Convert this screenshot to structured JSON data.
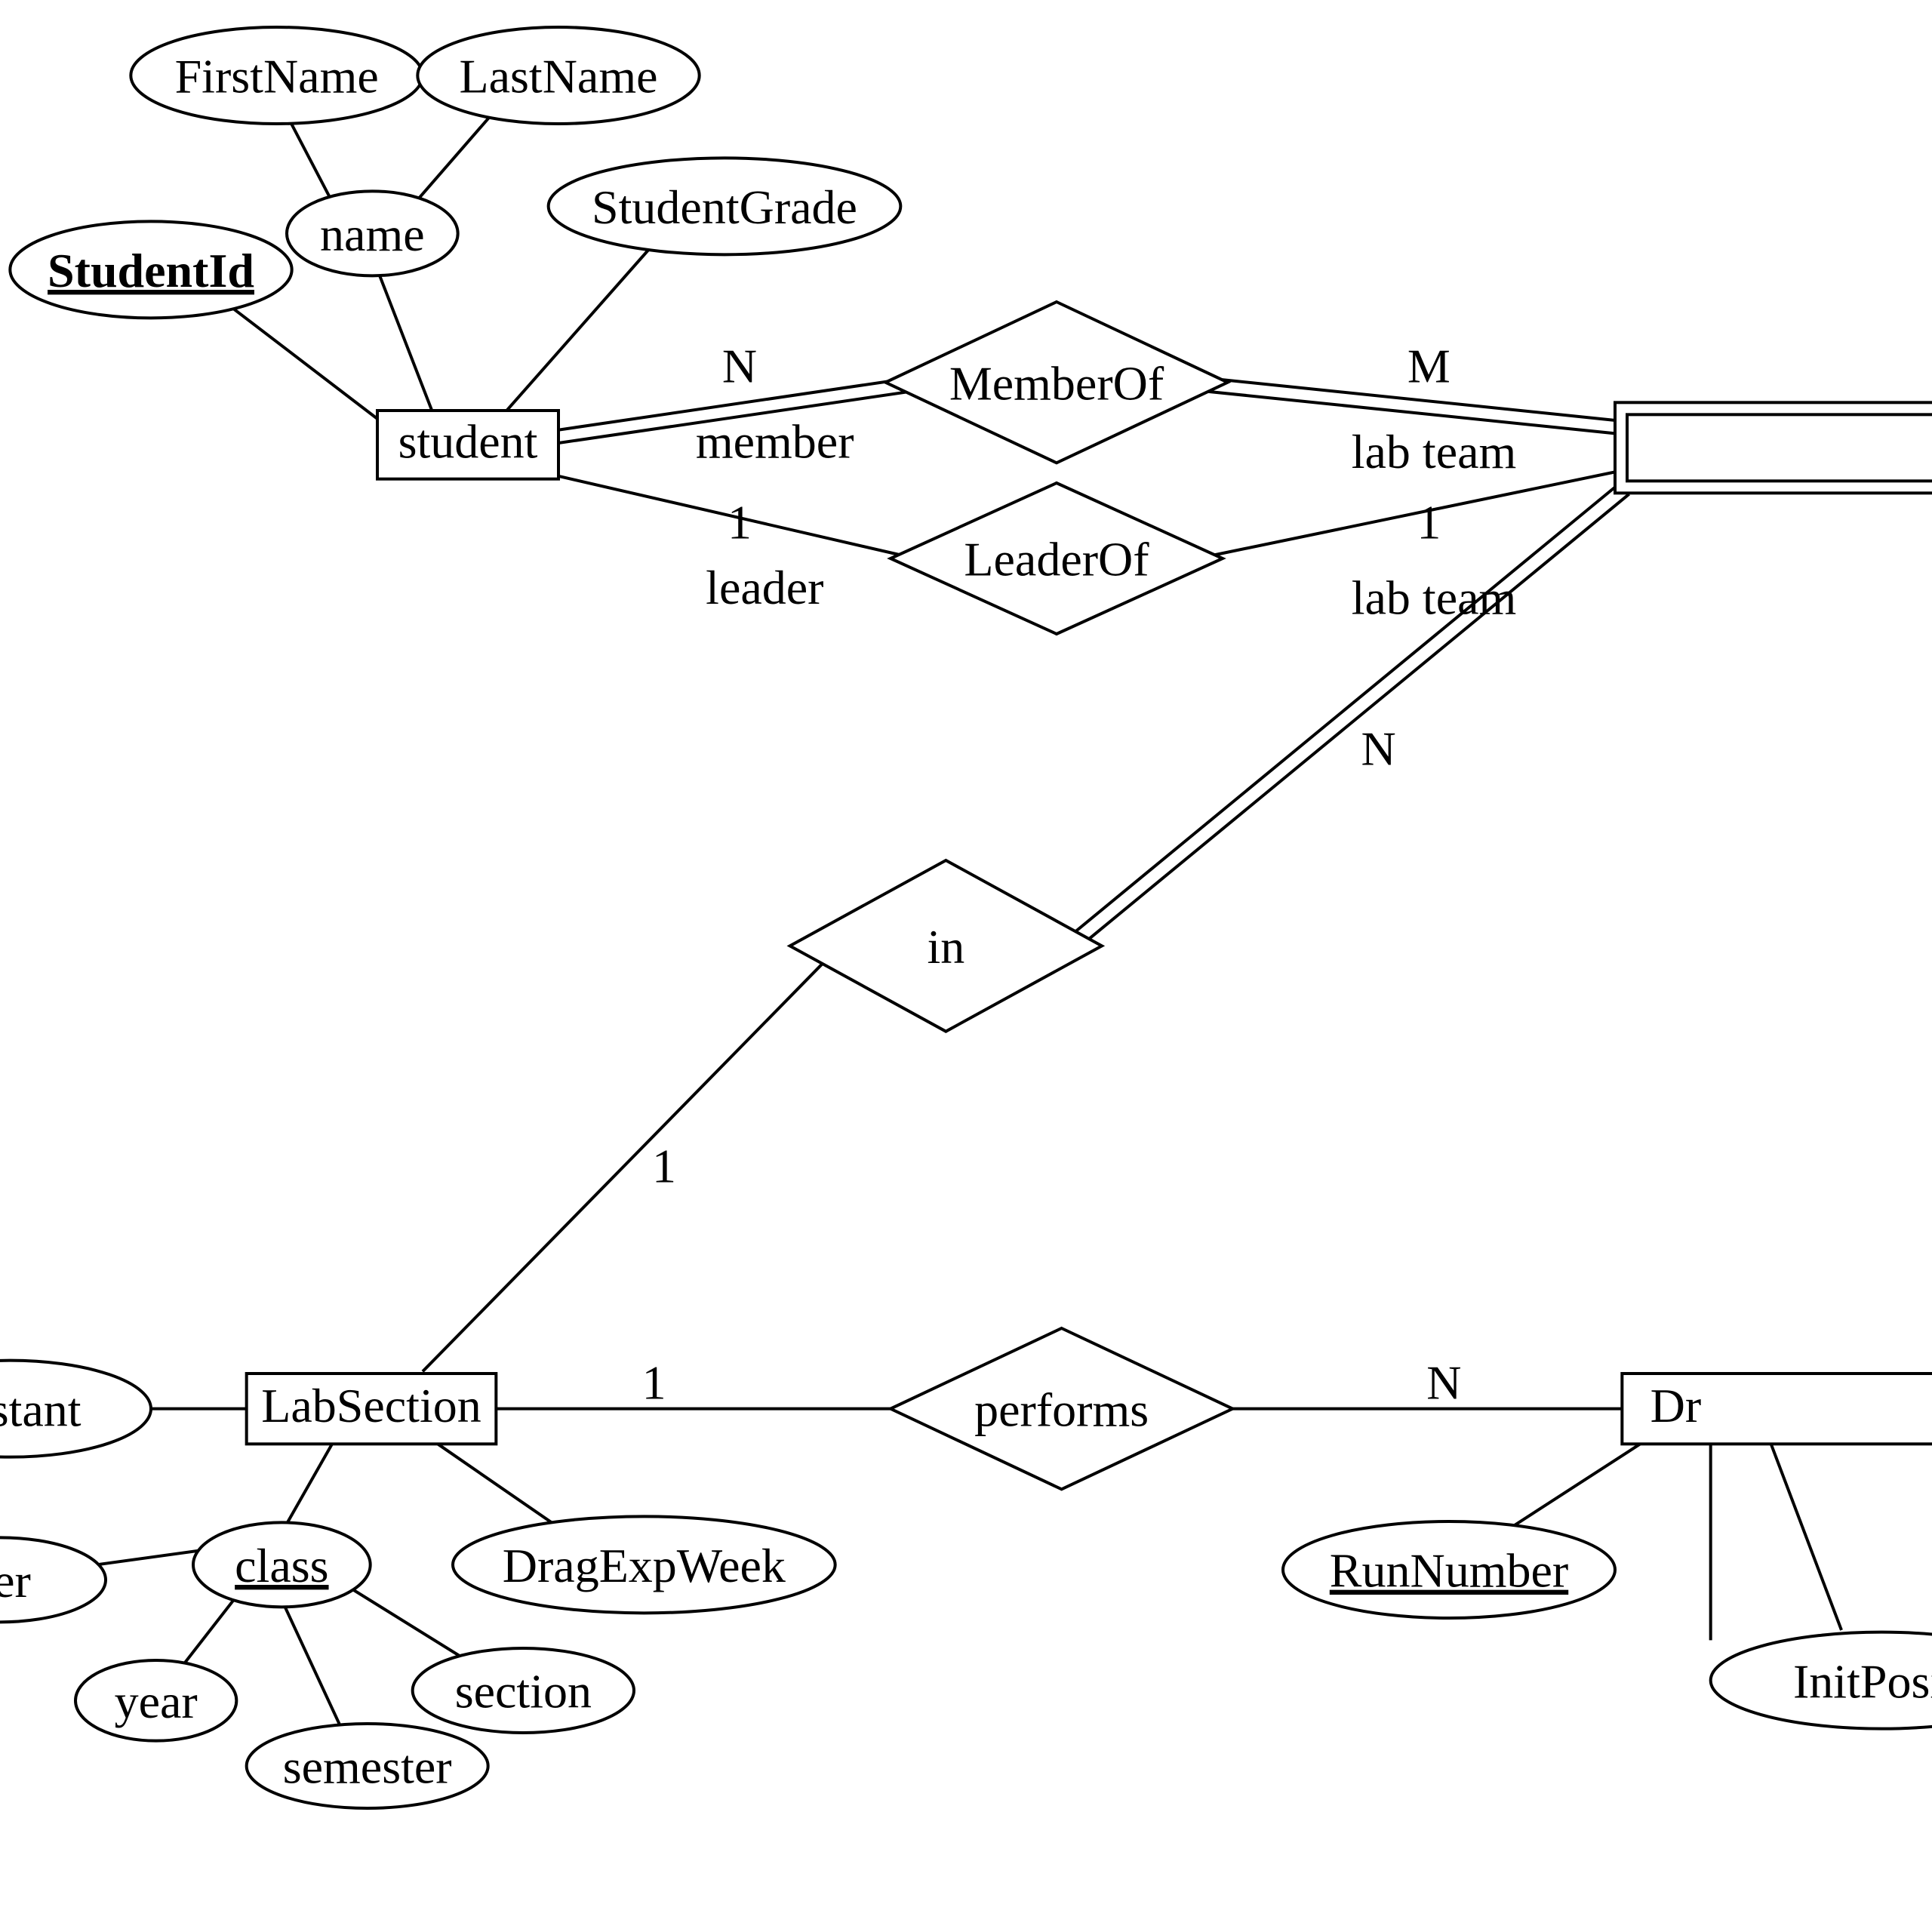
{
  "entities": {
    "student": "student",
    "labSection": "LabSection",
    "dragExp": "Dr"
  },
  "attributes": {
    "firstName": "FirstName",
    "lastName": "LastName",
    "name": "name",
    "studentId": "StudentId",
    "studentGrade": "StudentGrade",
    "assistant": "ssistant",
    "classAttr": "class",
    "year": "year",
    "semester": "semester",
    "section": "section",
    "number": "ber",
    "dragExpWeek": "DragExpWeek",
    "runNumber": "RunNumber",
    "initPosition": "InitPositi"
  },
  "relationships": {
    "memberOf": "MemberOf",
    "leaderOf": "LeaderOf",
    "in": "in",
    "performs": "performs"
  },
  "roles": {
    "member": "member",
    "leader": "leader",
    "labTeam1": "lab team",
    "labTeam2": "lab team"
  },
  "cardinalities": {
    "n1": "N",
    "m1": "M",
    "one1": "1",
    "one2": "1",
    "one3": "1",
    "one4": "1",
    "n2": "N",
    "n3": "N"
  }
}
